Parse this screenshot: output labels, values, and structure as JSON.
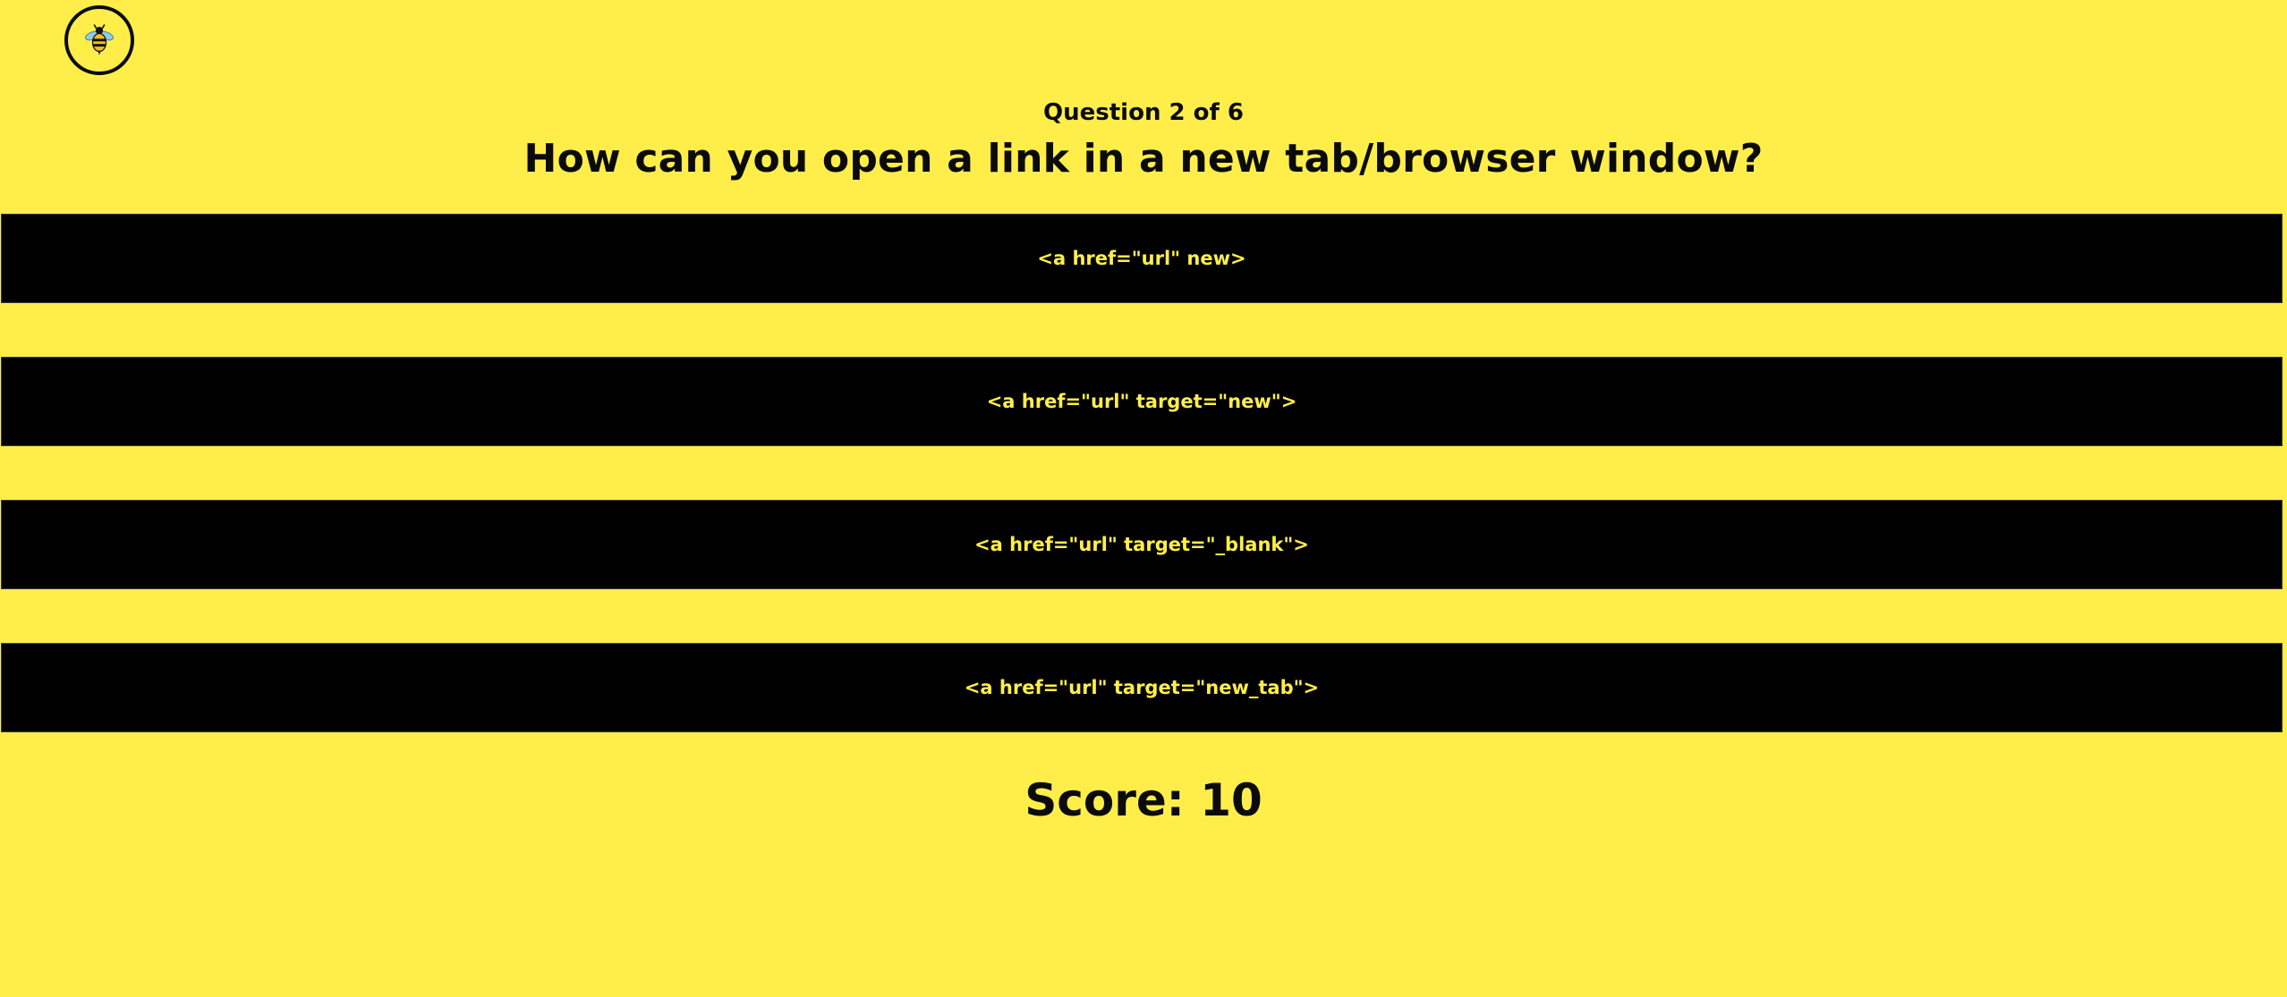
{
  "logo": {
    "icon": "bee-icon"
  },
  "quiz": {
    "progress": "Question 2 of 6",
    "question": "How can you open a link in a new tab/browser window?",
    "answers": [
      "<a href=\"url\" new>",
      "<a href=\"url\" target=\"new\">",
      "<a href=\"url\" target=\"_blank\">",
      "<a href=\"url\" target=\"new_tab\">"
    ],
    "score": "Score: 10"
  },
  "colors": {
    "background": "#ffee4a",
    "answer_background": "#000000",
    "answer_text": "#ffee4a",
    "text": "#0b0b0b"
  }
}
